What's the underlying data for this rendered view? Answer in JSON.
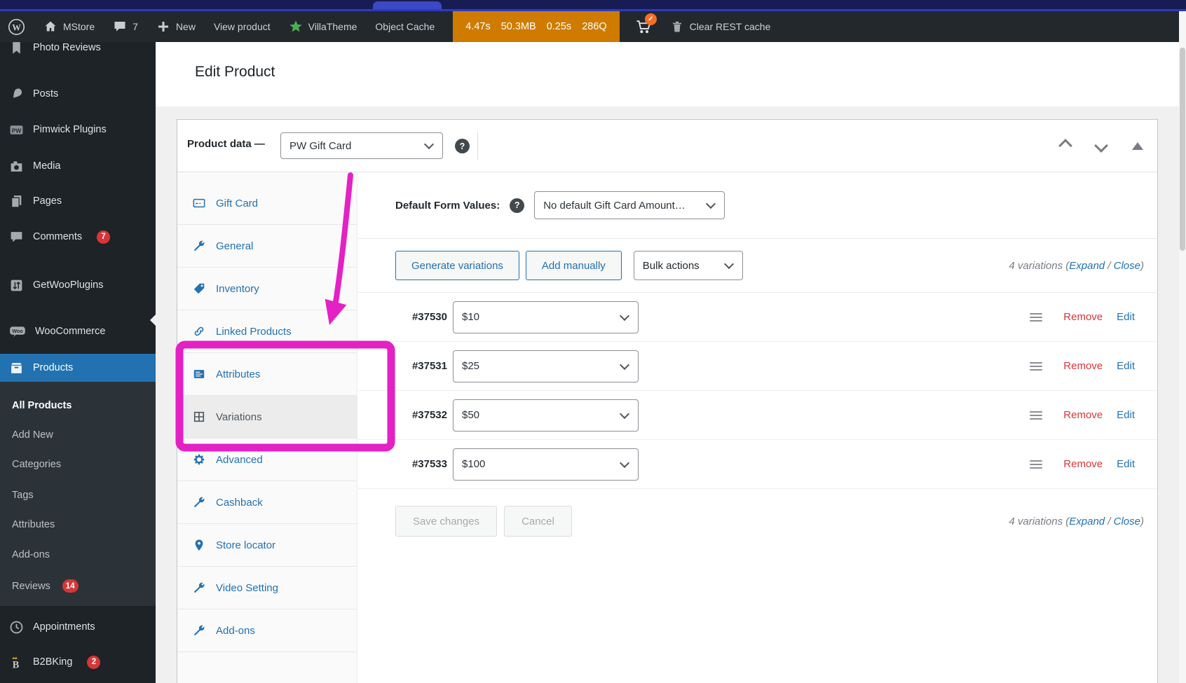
{
  "colors": {
    "accent_blue": "#2271b1",
    "badge_red": "#d63638",
    "highlight_magenta": "#e321c4",
    "qm_orange": "#ce7b00",
    "admin_bar_bg": "#23282d",
    "active_tab_bg": "#ececec"
  },
  "admin_bar": {
    "site_name": "MStore",
    "comment_count": "7",
    "new_label": "New",
    "view_product_label": "View product",
    "villatheme_label": "VillaTheme",
    "object_cache_label": "Object Cache",
    "perf": {
      "time": "4.47s",
      "memory": "50.3MB",
      "query_time": "0.25s",
      "queries": "286Q"
    },
    "clear_rest_cache_label": "Clear REST cache"
  },
  "sidebar": {
    "items": [
      {
        "label": "Photo Reviews"
      },
      {
        "label": "Posts"
      },
      {
        "label": "Pimwick Plugins"
      },
      {
        "label": "Media"
      },
      {
        "label": "Pages"
      },
      {
        "label": "Comments",
        "badge": "7"
      },
      {
        "label": "GetWooPlugins"
      },
      {
        "label": "WooCommerce"
      },
      {
        "label": "Products"
      }
    ],
    "submenu": [
      {
        "label": "All Products"
      },
      {
        "label": "Add New"
      },
      {
        "label": "Categories"
      },
      {
        "label": "Tags"
      },
      {
        "label": "Attributes"
      },
      {
        "label": "Add-ons"
      },
      {
        "label": "Reviews",
        "badge": "14"
      }
    ],
    "footer": [
      {
        "label": "Appointments"
      },
      {
        "label": "B2BKing",
        "badge": "2"
      }
    ]
  },
  "page": {
    "title": "Edit Product"
  },
  "panel": {
    "title": "Product data —",
    "product_type": "PW Gift Card",
    "tabs": [
      {
        "label": "Gift Card"
      },
      {
        "label": "General"
      },
      {
        "label": "Inventory"
      },
      {
        "label": "Linked Products"
      },
      {
        "label": "Attributes"
      },
      {
        "label": "Variations"
      },
      {
        "label": "Advanced"
      },
      {
        "label": "Cashback"
      },
      {
        "label": "Store locator"
      },
      {
        "label": "Video Setting"
      },
      {
        "label": "Add-ons"
      }
    ],
    "default_form_values_label": "Default Form Values:",
    "default_form_values_value": "No default Gift Card Amount…",
    "toolbar": {
      "generate_label": "Generate variations",
      "add_label": "Add manually",
      "bulk_label": "Bulk actions"
    },
    "summary": {
      "prefix": "4 variations (",
      "expand": "Expand",
      "separator": " / ",
      "close": "Close",
      "suffix": ")"
    },
    "rows": [
      {
        "id": "#37530",
        "amount": "$10"
      },
      {
        "id": "#37531",
        "amount": "$25"
      },
      {
        "id": "#37532",
        "amount": "$50"
      },
      {
        "id": "#37533",
        "amount": "$100"
      }
    ],
    "remove_label": "Remove",
    "edit_label": "Edit",
    "save_label": "Save changes",
    "cancel_label": "Cancel"
  }
}
